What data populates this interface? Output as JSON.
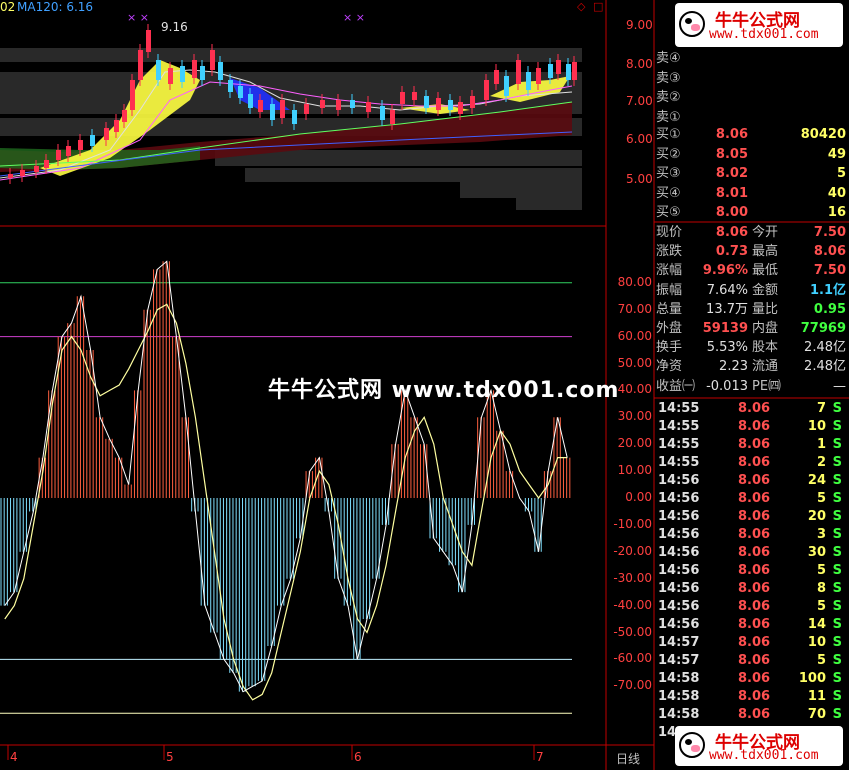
{
  "header": {
    "prefix": "02",
    "ma_label": "MA120: 6.16",
    "peak_label": "9.16",
    "x_marks": [
      "× ×",
      "× ×"
    ]
  },
  "price_axis": [
    "9.00",
    "8.00",
    "7.00",
    "6.00",
    "5.00"
  ],
  "indicator_axis": [
    "80.00",
    "70.00",
    "60.00",
    "50.00",
    "40.00",
    "30.00",
    "20.00",
    "10.00",
    "0.00",
    "-10.00",
    "-20.00",
    "-30.00",
    "-40.00",
    "-50.00",
    "-60.00",
    "-70.00"
  ],
  "date_axis": [
    "4",
    "5",
    "6",
    "7"
  ],
  "period_label": "日线",
  "sell_rows": [
    {
      "label": "卖④"
    },
    {
      "label": "卖③"
    },
    {
      "label": "卖②"
    },
    {
      "label": "卖①"
    }
  ],
  "buy_rows": [
    {
      "label": "买①",
      "price": "8.06",
      "volume": "80420"
    },
    {
      "label": "买②",
      "price": "8.05",
      "volume": "49"
    },
    {
      "label": "买③",
      "price": "8.02",
      "volume": "5"
    },
    {
      "label": "买④",
      "price": "8.01",
      "volume": "40"
    },
    {
      "label": "买⑤",
      "price": "8.00",
      "volume": "16"
    }
  ],
  "quote": {
    "r1": {
      "l1": "现价",
      "v1": "8.06",
      "l2": "今开",
      "v2": "7.50"
    },
    "r2": {
      "l1": "涨跌",
      "v1": "0.73",
      "l2": "最高",
      "v2": "8.06"
    },
    "r3": {
      "l1": "涨幅",
      "v1": "9.96%",
      "l2": "最低",
      "v2": "7.50"
    },
    "r4": {
      "l1": "振幅",
      "v1": "7.64%",
      "l2": "金额",
      "v2": "1.1亿"
    },
    "r5": {
      "l1": "总量",
      "v1": "13.7万",
      "l2": "量比",
      "v2": "0.95"
    },
    "r6": {
      "l1": "外盘",
      "v1": "59139",
      "l2": "内盘",
      "v2": "77969"
    },
    "r7": {
      "l1": "换手",
      "v1": "5.53%",
      "l2": "股本",
      "v2": "2.48亿"
    },
    "r8": {
      "l1": "净资",
      "v1": "2.23",
      "l2": "流通",
      "v2": "2.48亿"
    },
    "r9": {
      "l1": "收益㈠",
      "v1": "-0.013",
      "l2": "PE㈣",
      "v2": "—"
    }
  },
  "ticks": [
    {
      "time": "14:55",
      "price": "8.06",
      "vol": "7",
      "side": "S"
    },
    {
      "time": "14:55",
      "price": "8.06",
      "vol": "10",
      "side": "S"
    },
    {
      "time": "14:55",
      "price": "8.06",
      "vol": "1",
      "side": "S"
    },
    {
      "time": "14:55",
      "price": "8.06",
      "vol": "2",
      "side": "S"
    },
    {
      "time": "14:56",
      "price": "8.06",
      "vol": "24",
      "side": "S"
    },
    {
      "time": "14:56",
      "price": "8.06",
      "vol": "5",
      "side": "S"
    },
    {
      "time": "14:56",
      "price": "8.06",
      "vol": "20",
      "side": "S"
    },
    {
      "time": "14:56",
      "price": "8.06",
      "vol": "3",
      "side": "S"
    },
    {
      "time": "14:56",
      "price": "8.06",
      "vol": "30",
      "side": "S"
    },
    {
      "time": "14:56",
      "price": "8.06",
      "vol": "5",
      "side": "S"
    },
    {
      "time": "14:56",
      "price": "8.06",
      "vol": "8",
      "side": "S"
    },
    {
      "time": "14:56",
      "price": "8.06",
      "vol": "5",
      "side": "S"
    },
    {
      "time": "14:56",
      "price": "8.06",
      "vol": "14",
      "side": "S"
    },
    {
      "time": "14:57",
      "price": "8.06",
      "vol": "10",
      "side": "S"
    },
    {
      "time": "14:57",
      "price": "8.06",
      "vol": "5",
      "side": "S"
    },
    {
      "time": "14:58",
      "price": "8.06",
      "vol": "100",
      "side": "S"
    },
    {
      "time": "14:58",
      "price": "8.06",
      "vol": "11",
      "side": "S"
    },
    {
      "time": "14:58",
      "price": "8.06",
      "vol": "70",
      "side": "S"
    },
    {
      "time": "14:59",
      "price": "8.06",
      "vol": "",
      "side": ""
    }
  ],
  "watermark": {
    "main": "牛牛公式网 www.tdx001.com",
    "badge_title": "牛牛公式网",
    "badge_url": "www.tdx001.com"
  },
  "colors": {
    "up": "#ff3050",
    "down": "#40d0ff",
    "ma_yellow": "#ffff60",
    "axis_red": "#c00000"
  },
  "chart_data": {
    "type": "line",
    "indicator_bars": [
      -40,
      -35,
      -20,
      -5,
      15,
      40,
      60,
      65,
      75,
      55,
      30,
      22,
      15,
      5,
      40,
      70,
      85,
      88,
      60,
      30,
      -5,
      -40,
      -50,
      -60,
      -65,
      -72,
      -70,
      -68,
      -55,
      -40,
      -30,
      -15,
      10,
      15,
      -5,
      -30,
      -40,
      -60,
      -45,
      -30,
      -10,
      20,
      40,
      30,
      20,
      -15,
      -20,
      -25,
      -35,
      -10,
      30,
      40,
      25,
      10,
      0,
      -5,
      -20,
      10,
      30,
      15
    ],
    "indicator_line": [
      -45,
      -40,
      -30,
      -10,
      10,
      35,
      55,
      60,
      55,
      45,
      38,
      40,
      42,
      48,
      55,
      62,
      70,
      72,
      65,
      50,
      30,
      5,
      -20,
      -45,
      -60,
      -70,
      -75,
      -73,
      -65,
      -50,
      -35,
      -20,
      0,
      10,
      5,
      -10,
      -30,
      -45,
      -50,
      -40,
      -25,
      -5,
      15,
      25,
      30,
      20,
      0,
      -10,
      -20,
      -25,
      -5,
      15,
      25,
      20,
      10,
      5,
      0,
      5,
      15,
      15
    ],
    "ylim": [
      -80,
      95
    ]
  }
}
